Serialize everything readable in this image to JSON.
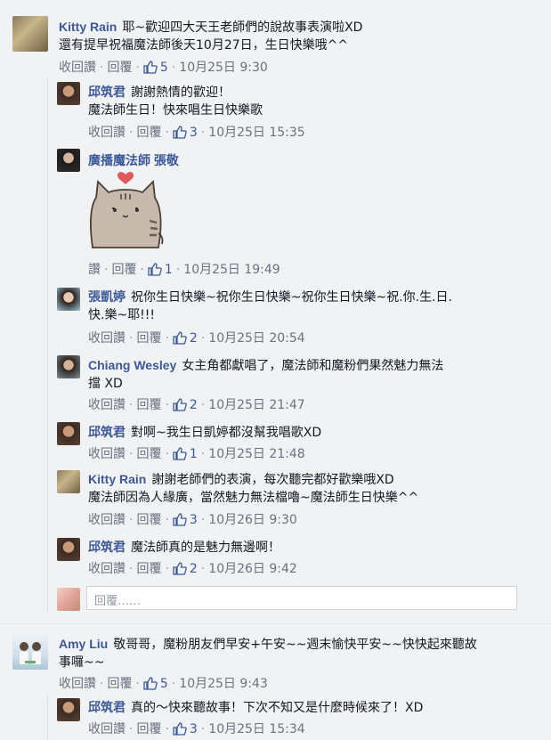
{
  "comments": [
    {
      "name": "Kitty Rain",
      "text": "耶~歡迎四大天王老師們的說故事表演啦XD",
      "text2": "還有提早祝福魔法師後天10月27日，生日快樂哦^^",
      "unlike": "收回讚",
      "reply": "回覆",
      "likes": "5",
      "time": "10月25日 9:30"
    },
    {
      "name": "邱筑君",
      "text": "謝謝熱情的歡迎！",
      "text2": "魔法師生日！快來唱生日快樂歌",
      "unlike": "收回讚",
      "reply": "回覆",
      "likes": "3",
      "time": "10月25日 15:35"
    },
    {
      "name": "廣播魔法師 張敬",
      "like": "讚",
      "reply": "回覆",
      "likes": "1",
      "time": "10月25日 19:49"
    },
    {
      "name": "張凱婷",
      "text": "祝你生日快樂~祝你生日快樂~祝你生日快樂~祝.你.生.日.",
      "text2": "快.樂~耶!!!",
      "unlike": "收回讚",
      "reply": "回覆",
      "likes": "2",
      "time": "10月25日 20:54"
    },
    {
      "name": "Chiang Wesley",
      "text": "女主角都獻唱了，魔法師和魔粉們果然魅力無法",
      "text2": "擋 XD",
      "unlike": "收回讚",
      "reply": "回覆",
      "likes": "2",
      "time": "10月25日 21:47"
    },
    {
      "name": "邱筑君",
      "text": "對啊~我生日凱婷都沒幫我唱歌XD",
      "unlike": "收回讚",
      "reply": "回覆",
      "likes": "1",
      "time": "10月25日 21:48"
    },
    {
      "name": "Kitty Rain",
      "text": "謝謝老師們的表演，每次聽完都好歡樂哦XD",
      "text2": "魔法師因為人緣廣，當然魅力無法檔嚕~魔法師生日快樂^^",
      "unlike": "收回讚",
      "reply": "回覆",
      "likes": "3",
      "time": "10月26日 9:30"
    },
    {
      "name": "邱筑君",
      "text": "魔法師真的是魅力無邊啊！",
      "unlike": "收回讚",
      "reply": "回覆",
      "likes": "2",
      "time": "10月26日 9:42"
    },
    {
      "name": "Amy Liu",
      "text": "敬哥哥，魔粉朋友們早安+午安~~週末愉快平安~~快快起來聽故",
      "text2": "事囉~~",
      "unlike": "收回讚",
      "reply": "回覆",
      "likes": "5",
      "time": "10月25日 9:43"
    },
    {
      "name": "邱筑君",
      "text": "真的～快來聽故事！下次不知又是什麼時候來了！XD",
      "unlike": "收回讚",
      "reply": "回覆",
      "likes": "3",
      "time": "10月25日 15:34"
    }
  ],
  "reply_placeholder": "回覆……",
  "colors": {
    "link": "#3b5998",
    "meta": "#6a7180",
    "background": "#f1f2f4"
  },
  "icons": {
    "like": "thumbs-up-icon"
  }
}
